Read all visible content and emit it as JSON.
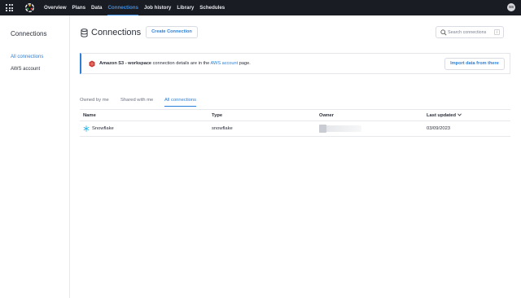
{
  "topbar": {
    "nav": [
      "Overview",
      "Plans",
      "Data",
      "Connections",
      "Job history",
      "Library",
      "Schedules"
    ],
    "active_index": 3,
    "avatar_initials": "SS"
  },
  "sidebar": {
    "title": "Connections",
    "items": [
      {
        "label": "All connections",
        "active": true
      },
      {
        "label": "AWS account",
        "active": false
      }
    ]
  },
  "header": {
    "title": "Connections",
    "create_label": "Create Connection",
    "search_placeholder": "Search connections",
    "search_shortcut": "/"
  },
  "banner": {
    "bold": "Amazon S3 - workspace",
    "text_before_link": " connection details are in the ",
    "link": "AWS account",
    "text_after_link": " page.",
    "import_label": "Import data from there"
  },
  "tabs": [
    {
      "label": "Owned by me",
      "active": false
    },
    {
      "label": "Shared with me",
      "active": false
    },
    {
      "label": "All connections",
      "active": true
    }
  ],
  "table": {
    "columns": [
      "Name",
      "Type",
      "Owner",
      "Last updated"
    ],
    "rows": [
      {
        "name": "Snowflake",
        "type": "snowflake",
        "owner": "",
        "updated": "03/09/2023"
      }
    ]
  },
  "colors": {
    "accent": "#2b7fd9",
    "topbar": "#1a1c24",
    "s3": "#c7372f",
    "snowflake": "#29b5e8"
  }
}
